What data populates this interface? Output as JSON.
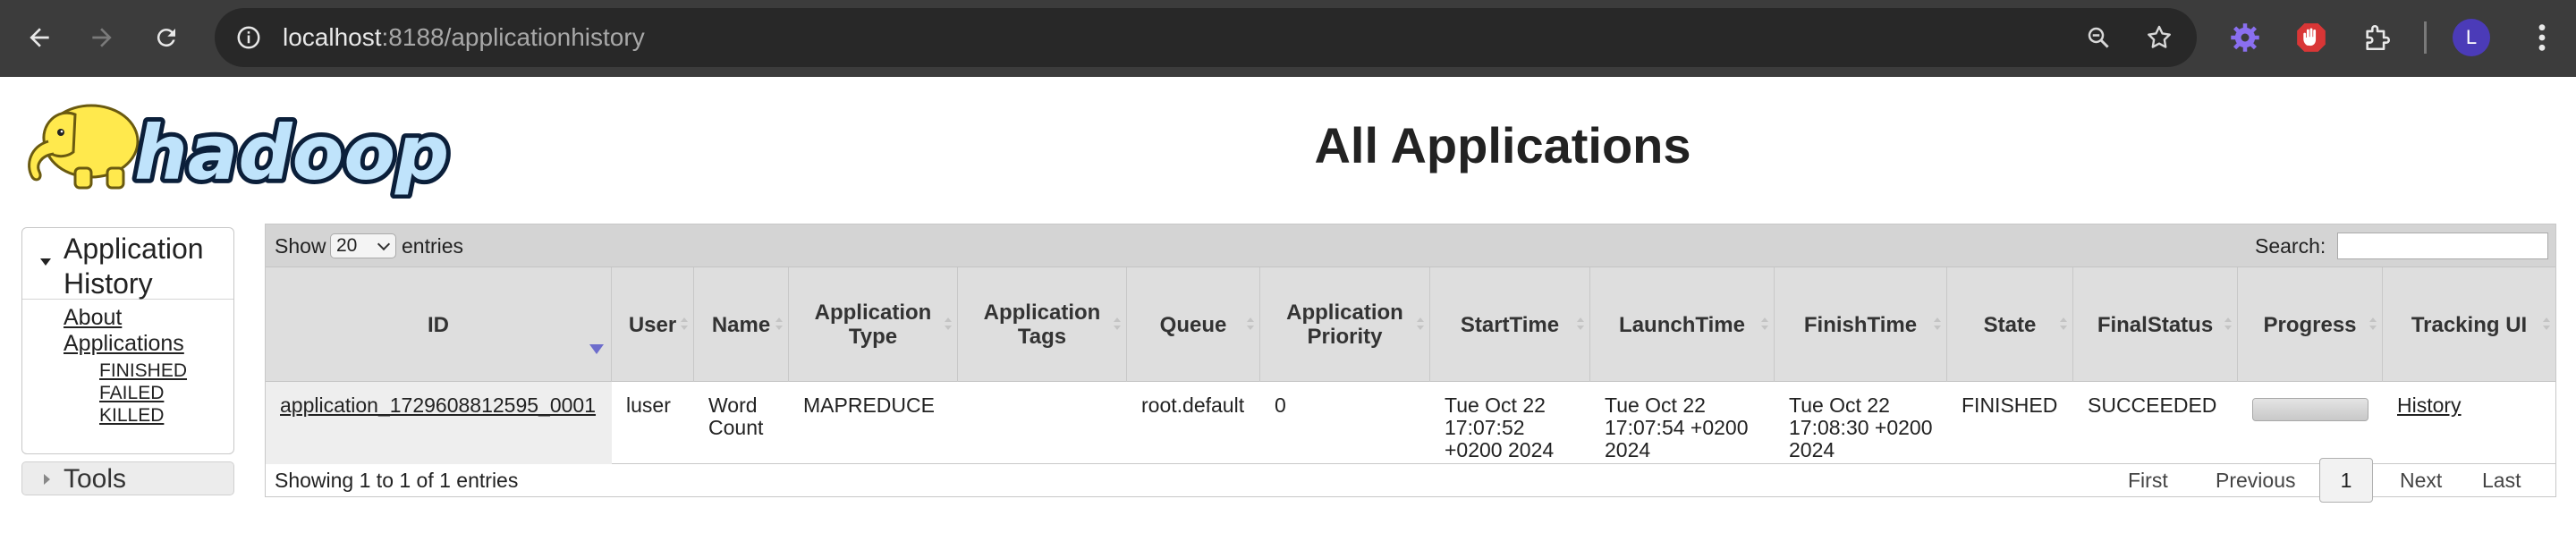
{
  "browser": {
    "url_host": "localhost",
    "url_rest": ":8188/applicationhistory",
    "profile_initial": "L"
  },
  "page": {
    "title": "All Applications",
    "logo_text": "hadoop"
  },
  "nav": {
    "section": "Application History",
    "about": "About Applications",
    "states": [
      "FINISHED",
      "FAILED",
      "KILLED"
    ],
    "tools": "Tools"
  },
  "table": {
    "show_label": "Show",
    "page_size": "20",
    "entries_label": "entries",
    "search_label": "Search:",
    "search_value": "",
    "columns": [
      "ID",
      "User",
      "Name",
      "Application Type",
      "Application Tags",
      "Queue",
      "Application Priority",
      "StartTime",
      "LaunchTime",
      "FinishTime",
      "State",
      "FinalStatus",
      "Progress",
      "Tracking UI"
    ],
    "rows": [
      {
        "id": "application_1729608812595_0001",
        "user": "luser",
        "name": "Word Count",
        "type": "MAPREDUCE",
        "tags": "",
        "queue": "root.default",
        "priority": "0",
        "start": "Tue Oct 22 17:07:52 +0200 2024",
        "launch": "Tue Oct 22 17:07:54 +0200 2024",
        "finish": "Tue Oct 22 17:08:30 +0200 2024",
        "state": "FINISHED",
        "final_status": "SUCCEEDED",
        "progress": 1.0,
        "tracking": "History"
      }
    ],
    "info": "Showing 1 to 1 of 1 entries",
    "pager": {
      "first": "First",
      "previous": "Previous",
      "current": "1",
      "next": "Next",
      "last": "Last"
    }
  },
  "colors": {
    "chrome_bg": "#3c3c3c",
    "omnibox_bg": "#282828",
    "header_bg": "#dedede",
    "toolbar_bg": "#d4d4d4",
    "logo_yellow": "#ffe94d",
    "logo_blue": "#1a4f8f"
  },
  "icons": [
    "back-arrow-icon",
    "forward-arrow-icon",
    "reload-icon",
    "site-info-icon",
    "zoom-icon",
    "bookmark-star-icon",
    "gear-extension-icon",
    "stop-hand-extension-icon",
    "puzzle-extension-icon",
    "more-menu-icon"
  ]
}
